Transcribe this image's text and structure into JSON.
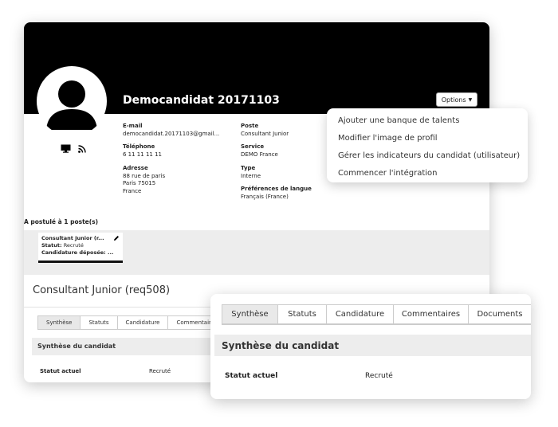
{
  "candidate": {
    "name": "Democandidat 20171103",
    "options_label": "Options",
    "fields": {
      "email": {
        "label": "E-mail",
        "value": "democandidat.20171103@gmail..."
      },
      "phone": {
        "label": "Téléphone",
        "value": "6 11 11 11 11"
      },
      "address": {
        "label": "Adresse",
        "line1": "88 rue de paris",
        "line2": "Paris 75015",
        "line3": "France"
      },
      "poste": {
        "label": "Poste",
        "value": "Consultant Junior"
      },
      "service": {
        "label": "Service",
        "value": "DEMO France"
      },
      "type": {
        "label": "Type",
        "value": "Interne"
      },
      "language": {
        "label": "Préférences de langue",
        "value": "Français (France)"
      }
    }
  },
  "applications": {
    "title": "A postulé à 1 poste(s)",
    "job": {
      "title": "Consultant Junior (r...",
      "statut_label": "Statut:",
      "statut_value": "Recruté",
      "candidature_label": "Candidature déposée: ..."
    }
  },
  "requisition": {
    "title": "Consultant Junior (req508)",
    "tabs": [
      "Synthèse",
      "Statuts",
      "Candidature",
      "Commentaires",
      "Documents"
    ],
    "summary_title": "Synthèse du candidat",
    "status_label": "Statut actuel",
    "status_value": "Recruté"
  },
  "dropdown": {
    "items": [
      "Ajouter une banque de talents",
      "Modifier l'image de profil",
      "Gérer les indicateurs du candidat (utilisateur)",
      "Commencer l'intégration"
    ]
  },
  "icons": [
    "user-avatar-icon",
    "monitor-icon",
    "rss-icon",
    "pencil-icon",
    "caret-down-icon"
  ],
  "colors": {
    "banner": "#000000",
    "page_bg": "#ededed",
    "active_tab": "#e9e9e9"
  }
}
